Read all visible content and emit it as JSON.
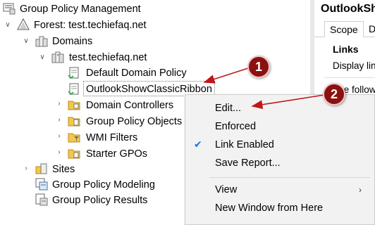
{
  "tree": {
    "root": {
      "label": "Group Policy Management",
      "icon": "gpm-console-icon"
    },
    "forest": {
      "label": "Forest: test.techiefaq.net",
      "icon": "forest-icon"
    },
    "domains": {
      "label": "Domains",
      "icon": "domains-folder-icon"
    },
    "domain": {
      "label": "test.techiefaq.net",
      "icon": "domain-icon"
    },
    "items": [
      {
        "label": "Default Domain Policy",
        "icon": "gpo-link-icon"
      },
      {
        "label": "OutlookShowClassicRibbon",
        "icon": "gpo-link-icon"
      },
      {
        "label": "Domain Controllers",
        "icon": "ou-folder-icon"
      },
      {
        "label": "Group Policy Objects",
        "icon": "gpo-folder-icon"
      },
      {
        "label": "WMI Filters",
        "icon": "wmi-folder-icon"
      },
      {
        "label": "Starter GPOs",
        "icon": "starter-gpo-folder-icon"
      }
    ],
    "sites": {
      "label": "Sites",
      "icon": "sites-icon"
    },
    "modeling": {
      "label": "Group Policy Modeling",
      "icon": "modeling-icon"
    },
    "results": {
      "label": "Group Policy Results",
      "icon": "results-icon"
    }
  },
  "right_pane": {
    "title": "OutlookShow",
    "tabs": [
      "Scope",
      "De"
    ],
    "links_heading": "Links",
    "text1": "Display link",
    "text2": "The following"
  },
  "context_menu": {
    "items": [
      "Edit...",
      "Enforced",
      "Link Enabled",
      "Save Report...",
      "View",
      "New Window from Here"
    ],
    "checked_item": "Link Enabled",
    "submenu_arrow": "›"
  },
  "annotations": {
    "badge1": "1",
    "badge2": "2",
    "color": "#8b1010"
  }
}
